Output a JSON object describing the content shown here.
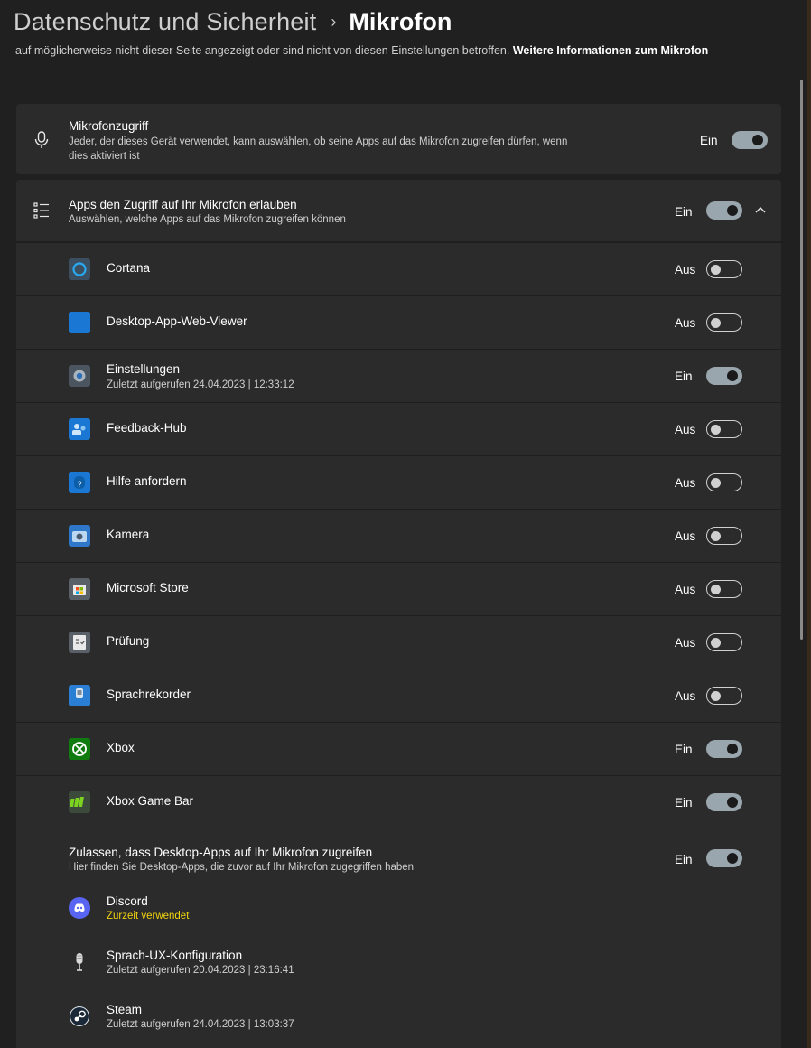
{
  "header": {
    "parent": "Datenschutz und Sicherheit",
    "separator": "›",
    "current": "Mikrofon"
  },
  "intro": {
    "text": "auf möglicherweise nicht dieser Seite angezeigt oder sind nicht von diesen Einstellungen betroffen.",
    "link": "Weitere Informationen zum Mikrofon"
  },
  "mic_access": {
    "title": "Mikrofonzugriff",
    "subtitle_line1": "Jeder, der dieses Gerät verwendet, kann auswählen, ob seine Apps auf das Mikrofon zugreifen dürfen, wenn",
    "subtitle_line2": "dies aktiviert ist",
    "state": "Ein",
    "on": true
  },
  "apps_access": {
    "title": "Apps den Zugriff auf Ihr Mikrofon erlauben",
    "subtitle": "Auswählen, welche Apps auf das Mikrofon zugreifen können",
    "state": "Ein",
    "on": true,
    "expanded": true
  },
  "apps": [
    {
      "name": "Cortana",
      "sub": "",
      "state": "Aus",
      "on": false,
      "icon": "cortana-icon",
      "color": "#3c4f60"
    },
    {
      "name": "Desktop-App-Web-Viewer",
      "sub": "",
      "state": "Aus",
      "on": false,
      "icon": "web-viewer-icon",
      "color": "#1a78d4"
    },
    {
      "name": "Einstellungen",
      "sub": "Zuletzt aufgerufen 24.04.2023  |  12:33:12",
      "state": "Ein",
      "on": true,
      "icon": "settings-gear-icon",
      "color": "#4a5560"
    },
    {
      "name": "Feedback-Hub",
      "sub": "",
      "state": "Aus",
      "on": false,
      "icon": "feedback-hub-icon",
      "color": "#1a78d4"
    },
    {
      "name": "Hilfe anfordern",
      "sub": "",
      "state": "Aus",
      "on": false,
      "icon": "get-help-icon",
      "color": "#1a78d4"
    },
    {
      "name": "Kamera",
      "sub": "",
      "state": "Aus",
      "on": false,
      "icon": "camera-icon",
      "color": "#2f77c8"
    },
    {
      "name": "Microsoft Store",
      "sub": "",
      "state": "Aus",
      "on": false,
      "icon": "store-icon",
      "color": "#5a6068"
    },
    {
      "name": "Prüfung",
      "sub": "",
      "state": "Aus",
      "on": false,
      "icon": "exam-icon",
      "color": "#5a6068"
    },
    {
      "name": "Sprachrekorder",
      "sub": "",
      "state": "Aus",
      "on": false,
      "icon": "voice-recorder-icon",
      "color": "#2a7fd4"
    },
    {
      "name": "Xbox",
      "sub": "",
      "state": "Ein",
      "on": true,
      "icon": "xbox-icon",
      "color": "#107c10"
    },
    {
      "name": "Xbox Game Bar",
      "sub": "",
      "state": "Ein",
      "on": true,
      "icon": "xbox-game-bar-icon",
      "color": "#3c4a3c"
    }
  ],
  "desktop_access": {
    "title": "Zulassen, dass Desktop-Apps auf Ihr Mikrofon zugreifen",
    "subtitle": "Hier finden Sie Desktop-Apps, die zuvor auf Ihr Mikrofon zugegriffen haben",
    "state": "Ein",
    "on": true
  },
  "desktop_apps": [
    {
      "name": "Discord",
      "sub": "Zurzeit verwendet",
      "highlight": true,
      "icon": "discord-icon",
      "color": "#5865f2"
    },
    {
      "name": "Sprach-UX-Konfiguration",
      "sub": "Zuletzt aufgerufen 20.04.2023  |  23:16:41",
      "highlight": false,
      "icon": "microphone-config-icon",
      "color": "#2b2b2b"
    },
    {
      "name": "Steam",
      "sub": "Zuletzt aufgerufen 24.04.2023  |  13:03:37",
      "highlight": false,
      "icon": "steam-icon",
      "color": "#1b2838"
    }
  ]
}
